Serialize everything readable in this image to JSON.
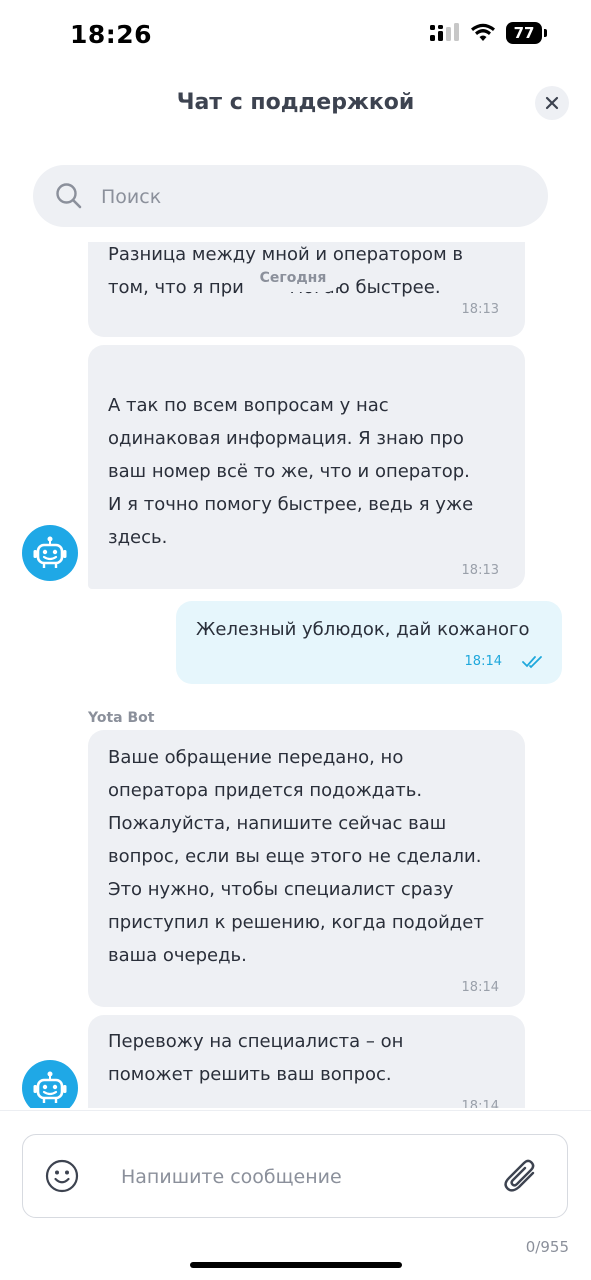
{
  "status": {
    "time": "18:26",
    "battery": "77"
  },
  "header": {
    "title": "Чат с поддержкой"
  },
  "search": {
    "placeholder": "Поиск"
  },
  "date_chip": "Сегодня",
  "messages": [
    {
      "lines": [
        "Разница между мной и оператором в",
        "том, что я при        могаю быстрее."
      ],
      "time": "18:13"
    },
    {
      "lines": [
        "А так по всем вопросам у нас",
        "одинаковая информация. Я знаю про",
        "ваш номер всё то же, что и оператор.",
        "И я точно помогу быстрее, ведь я уже",
        "здесь."
      ],
      "time": "18:13"
    },
    {
      "lines": [
        "Железный ублюдок, дай кожаного"
      ],
      "time": "18:14"
    },
    {
      "sender": "Yota Bot",
      "lines": [
        "Ваше обращение передано, но",
        "оператора придется подождать.",
        "Пожалуйста, напишите сейчас ваш",
        "вопрос, если вы еще этого не сделали.",
        "Это нужно, чтобы специалист сразу",
        "приступил к решению, когда подойдет",
        "ваша очередь."
      ],
      "time": "18:14"
    },
    {
      "lines": [
        "Перевожу на специалиста – он",
        "поможет решить ваш вопрос."
      ],
      "time": "18:14"
    }
  ],
  "composer": {
    "placeholder": "Напишите сообщение",
    "counter": "0/955"
  },
  "colors": {
    "accent": "#1fa8e6",
    "bubble_in": "#eef0f4",
    "bubble_out": "#e6f6fc"
  }
}
